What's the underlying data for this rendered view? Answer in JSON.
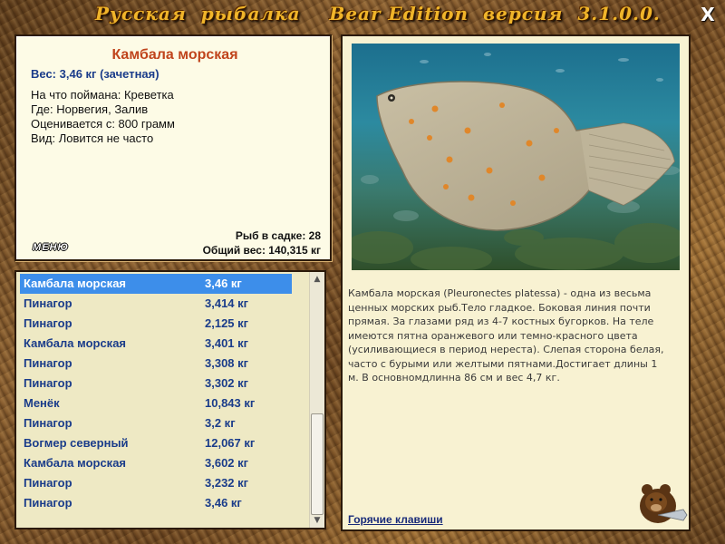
{
  "window": {
    "title": "Русская  рыбалка    Bear Edition  версия  3.1.0.0.",
    "close_label": "X"
  },
  "catch_info": {
    "fish_name": "Камбала морская",
    "weight_line": "Вес: 3,46 кг (зачетная)",
    "details": [
      "На что поймана: Креветка",
      "Где: Норвегия, Залив",
      "Оценивается с: 800 грамм",
      "Вид: Ловится не часто"
    ],
    "menu_button": "МЕНЮ",
    "fish_in_cage": "Рыб в садке: 28",
    "total_weight": "Общий вес: 140,315 кг"
  },
  "catch_list": {
    "selected_index": 0,
    "rows": [
      {
        "name": "Камбала морская",
        "weight": "3,46 кг"
      },
      {
        "name": "Пинагор",
        "weight": "3,414 кг"
      },
      {
        "name": "Пинагор",
        "weight": "2,125 кг"
      },
      {
        "name": "Камбала морская",
        "weight": "3,401 кг"
      },
      {
        "name": "Пинагор",
        "weight": "3,308 кг"
      },
      {
        "name": "Пинагор",
        "weight": "3,302 кг"
      },
      {
        "name": "Менёк",
        "weight": "10,843 кг"
      },
      {
        "name": "Пинагор",
        "weight": "3,2 кг"
      },
      {
        "name": "Вогмер северный",
        "weight": "12,067 кг"
      },
      {
        "name": "Камбала морская",
        "weight": "3,602 кг"
      },
      {
        "name": "Пинагор",
        "weight": "3,232 кг"
      },
      {
        "name": "Пинагор",
        "weight": "3,46 кг"
      }
    ]
  },
  "fish_card": {
    "description": "Камбала морская (Pleuronectes platessa) - одна из весьма ценных морских рыб.Тело гладкое. Боковая линия почти прямая. За глазами ряд из 4-7 костных бугорков. На теле имеются пятна оранжевого или темно-красного цвета (усиливающиеся в период нереста). Слепая сторона белая, часто с бурыми или желтыми пятнами.Достигает длины 1 м. В основномдлинна 86 см и вес 4,7 кг.",
    "hotkeys_link": "Горячие клавиши"
  },
  "icons": {
    "close": "close-icon",
    "scroll_up": "scroll-up-icon",
    "scroll_down": "scroll-down-icon",
    "logo": "bear-with-fish-logo"
  },
  "colors": {
    "fish_name": "#c0441c",
    "weight_text": "#1a3c8a",
    "selection": "#3d8eea",
    "title_gold": "#f0b52a"
  }
}
